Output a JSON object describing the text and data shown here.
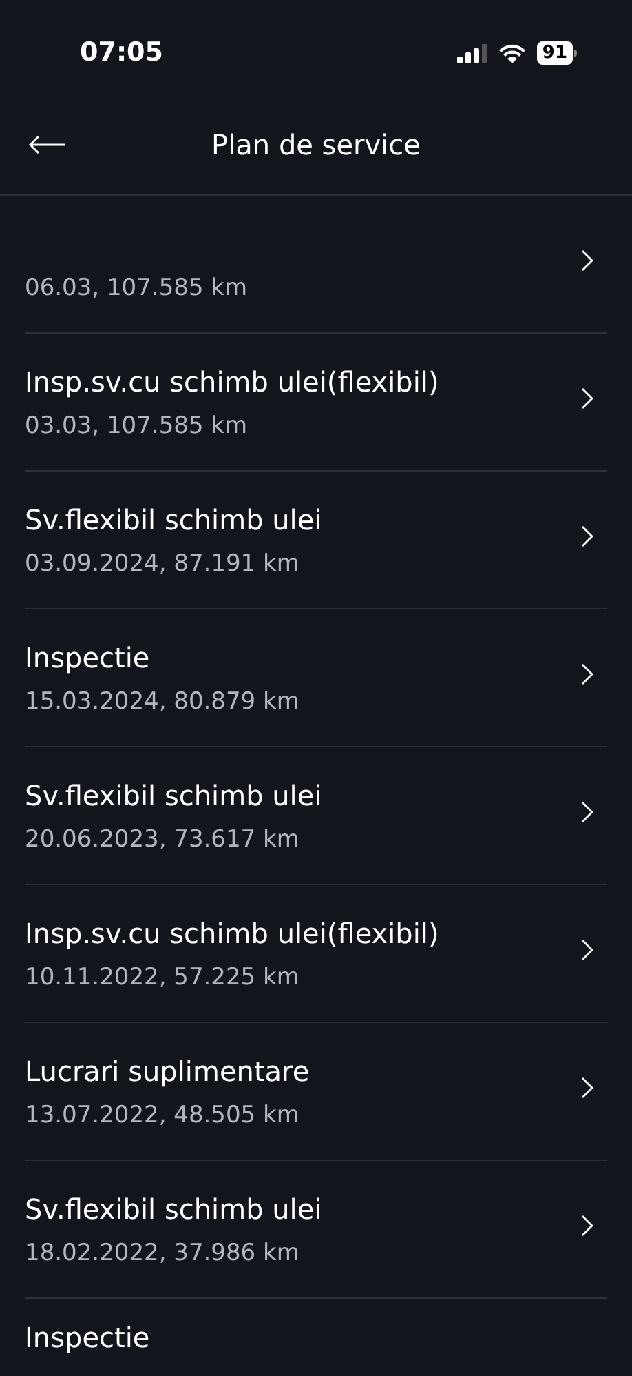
{
  "status_bar": {
    "time": "07:05",
    "battery": "91"
  },
  "header": {
    "title": "Plan de service"
  },
  "entries": [
    {
      "date": "06.03, 107.585 km"
    },
    {
      "title": "Insp.sv.cu schimb ulei(flexibil)",
      "date": "03.03, 107.585 km"
    },
    {
      "title": "Sv.flexibil schimb ulei",
      "date": "03.09.2024, 87.191 km"
    },
    {
      "title": "Inspectie",
      "date": "15.03.2024, 80.879 km"
    },
    {
      "title": "Sv.flexibil schimb ulei",
      "date": "20.06.2023, 73.617 km"
    },
    {
      "title": "Insp.sv.cu schimb ulei(flexibil)",
      "date": "10.11.2022, 57.225 km"
    },
    {
      "title": "Lucrari suplimentare",
      "date": "13.07.2022, 48.505 km"
    },
    {
      "title": "Sv.flexibil schimb ulei",
      "date": "18.02.2022, 37.986 km"
    },
    {
      "title": "Inspectie"
    }
  ]
}
